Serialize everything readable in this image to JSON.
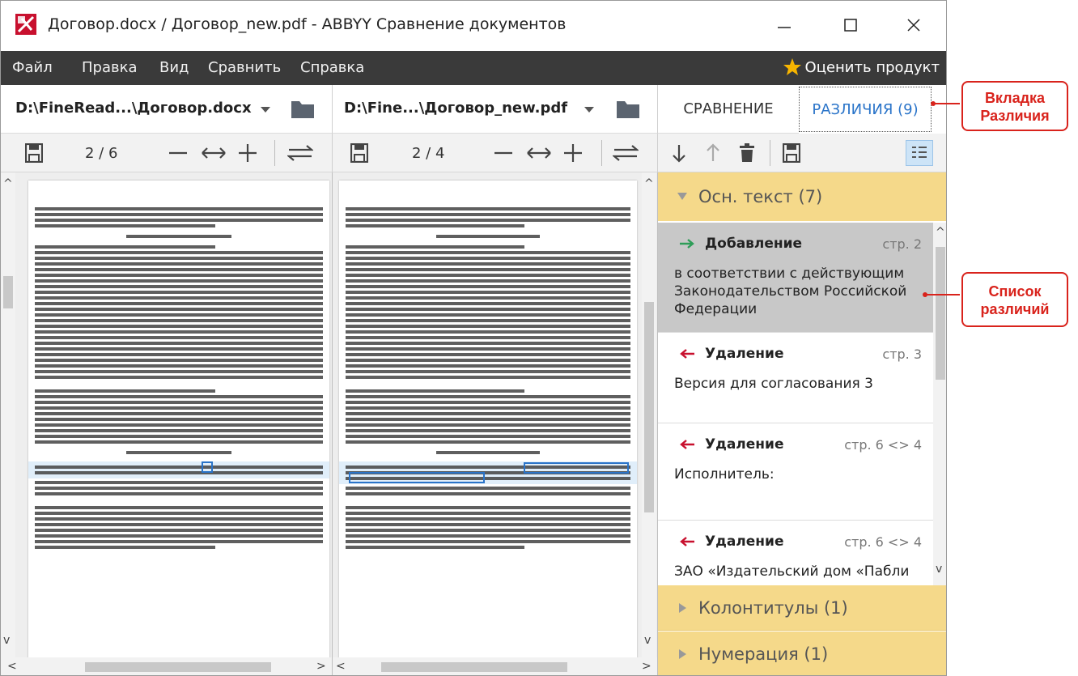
{
  "window": {
    "title": "Договор.docx / Договор_new.pdf - ABBYY Сравнение документов"
  },
  "menu": {
    "items": [
      "Файл",
      "Правка",
      "Вид",
      "Сравнить",
      "Справка"
    ],
    "rate_label": "Оценить продукт"
  },
  "left_doc": {
    "path": "D:\\FineRead...\\Договор.docx",
    "page": "2 / 6"
  },
  "right_doc": {
    "path": "D:\\Fine...\\Договор_new.pdf",
    "page": "2 / 4"
  },
  "tabs": {
    "compare": "СРАВНЕНИЕ",
    "differences": "РАЗЛИЧИЯ (9)"
  },
  "groups": {
    "main_text": "Осн. текст (7)",
    "headers": "Колонтитулы (1)",
    "numbering": "Нумерация (1)"
  },
  "diffs": [
    {
      "type": "Добавление",
      "page": "стр. 2",
      "text": "в соответствии с действующим Законодательством Российской Федерации",
      "kind": "add"
    },
    {
      "type": "Удаление",
      "page": "стр. 3",
      "text": "Версия для согласования 3",
      "kind": "del"
    },
    {
      "type": "Удаление",
      "page": "стр. 6 <> 4",
      "text": "Исполнитель:",
      "kind": "del"
    },
    {
      "type": "Удаление",
      "page": "стр. 6 <> 4",
      "text": "ЗАО «Издательский дом «Пабли",
      "kind": "del"
    }
  ],
  "annotations": {
    "tab": "Вкладка Различия",
    "list": "Список различий"
  },
  "colors": {
    "menubar": "#3a3a3a",
    "group_header": "#f5d98a",
    "selected_item": "#c8c8c8",
    "tab_active": "#2a74c9",
    "add_arrow": "#2e9d58",
    "del_arrow": "#c8102e",
    "annotation": "#d9231c"
  }
}
